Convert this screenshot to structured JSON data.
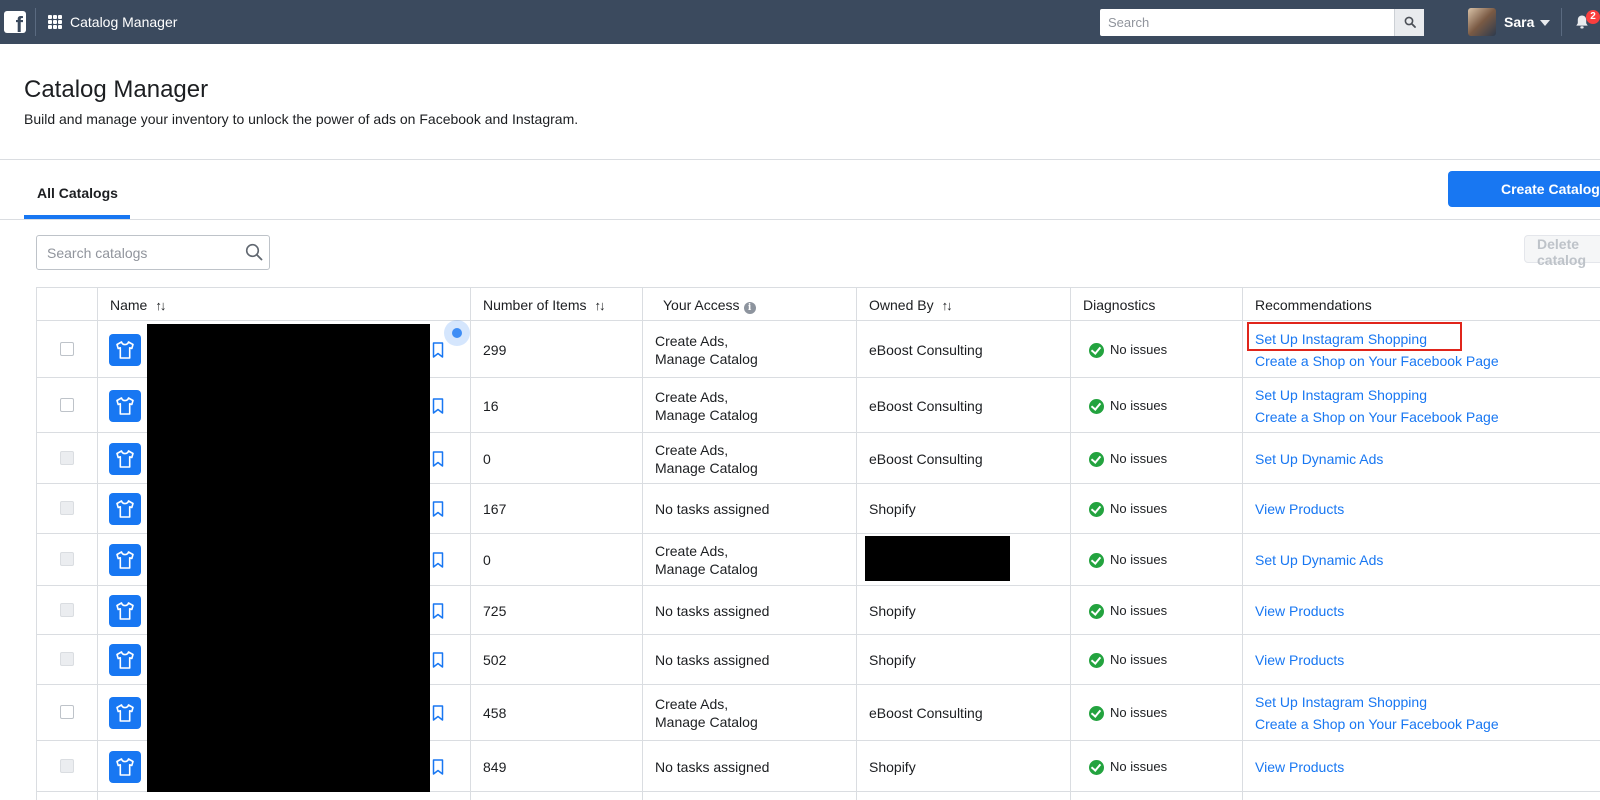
{
  "topbar": {
    "logo": "f",
    "app_title": "Catalog Manager",
    "search_placeholder": "Search",
    "user_name": "Sara",
    "notification_count": "2",
    "bg_color": "#3b4a5e"
  },
  "header": {
    "title": "Catalog Manager",
    "subtitle": "Build and manage your inventory to unlock the power of ads on Facebook and Instagram."
  },
  "tabs": [
    {
      "label": "All Catalogs",
      "active": true
    }
  ],
  "actions": {
    "create_label": "Create Catalog",
    "delete_label": "Delete catalog"
  },
  "catalog_search": {
    "placeholder": "Search catalogs"
  },
  "table": {
    "columns": {
      "name": "Name",
      "items": "Number of Items",
      "access": "Your Access",
      "owner": "Owned By",
      "diagnostics": "Diagnostics",
      "recommendations": "Recommendations"
    },
    "rows": [
      {
        "items": "299",
        "access": [
          "Create Ads,",
          "Manage Catalog"
        ],
        "owner": "eBoost Consulting",
        "diagnostics": "No issues",
        "recommendations": [
          "Set Up Instagram Shopping",
          "Create a Shop on Your Facebook Page"
        ]
      },
      {
        "items": "16",
        "access": [
          "Create Ads,",
          "Manage Catalog"
        ],
        "owner": "eBoost Consulting",
        "diagnostics": "No issues",
        "recommendations": [
          "Set Up Instagram Shopping",
          "Create a Shop on Your Facebook Page"
        ]
      },
      {
        "items": "0",
        "access": [
          "Create Ads,",
          "Manage Catalog"
        ],
        "owner": "eBoost Consulting",
        "diagnostics": "No issues",
        "recommendations": [
          "Set Up Dynamic Ads"
        ]
      },
      {
        "items": "167",
        "access": [
          "No tasks assigned"
        ],
        "owner": "Shopify",
        "diagnostics": "No issues",
        "recommendations": [
          "View Products"
        ]
      },
      {
        "items": "0",
        "access": [
          "Create Ads,",
          "Manage Catalog"
        ],
        "owner": "",
        "diagnostics": "No issues",
        "recommendations": [
          "Set Up Dynamic Ads"
        ]
      },
      {
        "items": "725",
        "access": [
          "No tasks assigned"
        ],
        "owner": "Shopify",
        "diagnostics": "No issues",
        "recommendations": [
          "View Products"
        ]
      },
      {
        "items": "502",
        "access": [
          "No tasks assigned"
        ],
        "owner": "Shopify",
        "diagnostics": "No issues",
        "recommendations": [
          "View Products"
        ]
      },
      {
        "items": "458",
        "access": [
          "Create Ads,",
          "Manage Catalog"
        ],
        "owner": "eBoost Consulting",
        "diagnostics": "No issues",
        "recommendations": [
          "Set Up Instagram Shopping",
          "Create a Shop on Your Facebook Page"
        ]
      },
      {
        "items": "849",
        "access": [
          "No tasks assigned"
        ],
        "owner": "Shopify",
        "diagnostics": "No issues",
        "recommendations": [
          "View Products"
        ]
      }
    ]
  },
  "colors": {
    "accent": "#1877f2",
    "success": "#23a33f",
    "highlight": "#e0251b"
  }
}
